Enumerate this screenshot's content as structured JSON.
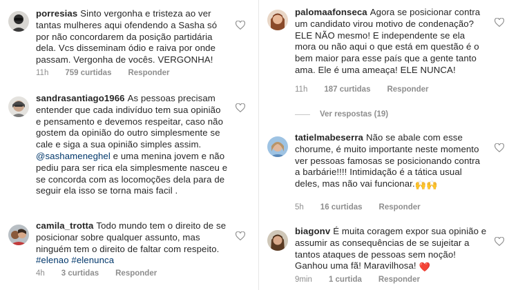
{
  "left": [
    {
      "username": "porresias",
      "segments": [
        {
          "t": "Sinto vergonha e tristeza ao ver tantas mulheres aqui ofendendo a Sasha só por não concordarem da posição partidária dela.  Vcs disseminam ódio e raiva por onde passam. Vergonha de vocês. VERGONHA!",
          "k": "text"
        }
      ],
      "time": "11h",
      "likes": "759 curtidas",
      "reply": "Responder"
    },
    {
      "username": "sandrasantiago1966",
      "segments": [
        {
          "t": "As pessoas precisam entender que cada indivíduo tem sua opinião e pensamento e devemos respeitar, caso não gostem da opinião do outro simplesmente se cale e siga a sua opinião simples assim. ",
          "k": "text"
        },
        {
          "t": "@sashameneghel",
          "k": "tag"
        },
        {
          "t": " e uma menina jovem e não pediu para ser rica ela simplesmente nasceu e se concorda com as locomoções dela para de seguir ela isso se torna mais facil .",
          "k": "text"
        }
      ],
      "time": "",
      "likes": "",
      "reply": ""
    },
    {
      "username": "camila_trotta",
      "segments": [
        {
          "t": "Todo mundo tem o direito de se posicionar sobre qualquer assunto, mas ninguém tem o direito de faltar com respeito. ",
          "k": "text"
        },
        {
          "t": "#elenao",
          "k": "tag"
        },
        {
          "t": " ",
          "k": "text"
        },
        {
          "t": "#elenunca",
          "k": "tag"
        }
      ],
      "time": "4h",
      "likes": "3 curtidas",
      "reply": "Responder"
    }
  ],
  "right": [
    {
      "username": "palomaafonseca",
      "segments": [
        {
          "t": "Agora se posicionar contra um candidato virou motivo de condenação? ELE NÃO mesmo! E independente se ela mora ou não aqui o que está em questão é o bem maior para esse país que a gente tanto ama. Ele é uma ameaça! ELE NUNCA!",
          "k": "text"
        }
      ],
      "time": "11h",
      "likes": "187 curtidas",
      "reply": "Responder"
    },
    {
      "username": "tatielmabeserra",
      "segments": [
        {
          "t": "Não se abale com esse chorume, é muito importante neste momento ver pessoas famosas se posicionando contra a barbárie!!!! Intimidação é a tática usual deles, mas não vai funcionar.",
          "k": "text"
        },
        {
          "t": "🙌🙌",
          "k": "emoji"
        }
      ],
      "time": "5h",
      "likes": "16 curtidas",
      "reply": "Responder"
    },
    {
      "username": "biagonv",
      "segments": [
        {
          "t": "É muita coragem expor sua opinião e assumir as consequências de se sujeitar a tantos ataques de pessoas sem noção! Ganhou uma fã! Maravilhosa! ",
          "k": "text"
        },
        {
          "t": "❤️",
          "k": "emoji"
        }
      ],
      "time": "9min",
      "likes": "1 curtida",
      "reply": "Responder"
    }
  ],
  "view_replies": "Ver respostas (19)",
  "icons": {
    "heart": "heart-outline-icon",
    "avatar": "avatar"
  },
  "colors": {
    "text": "#262626",
    "meta": "#8e8e8e",
    "tag": "#00376b",
    "heart": "#8e8e8e"
  }
}
